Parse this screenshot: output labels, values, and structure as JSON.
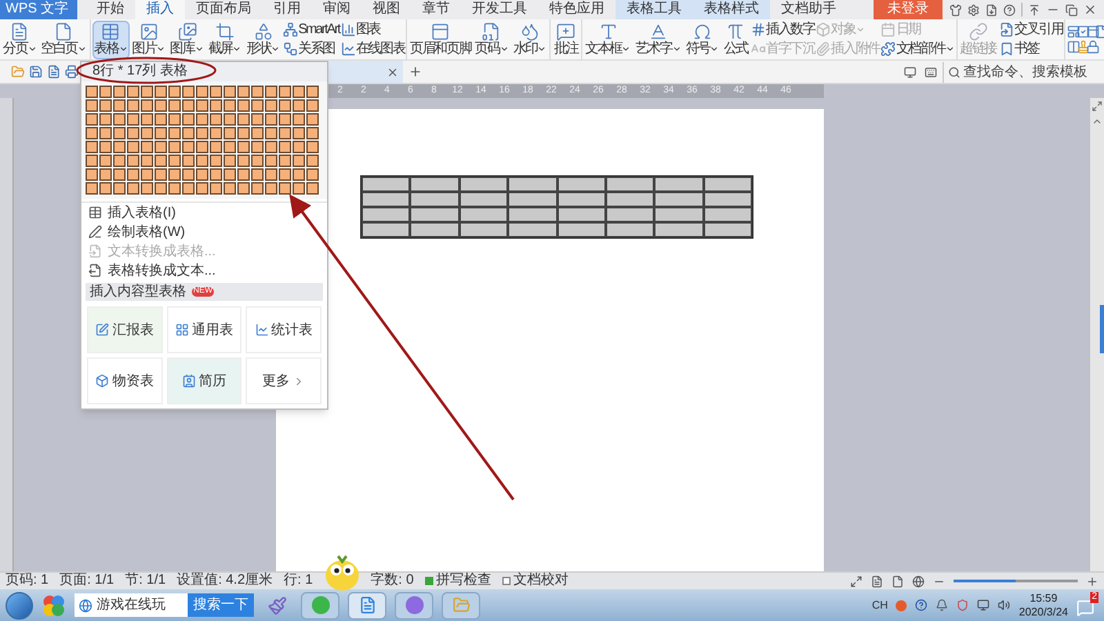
{
  "app_button": {
    "label": "WPS 文字"
  },
  "menu_tabs": [
    {
      "label": "开始",
      "selected": false,
      "kind": "plain"
    },
    {
      "label": "插入",
      "selected": true,
      "kind": "plain"
    },
    {
      "label": "页面布局",
      "selected": false,
      "kind": "plain"
    },
    {
      "label": "引用",
      "selected": false,
      "kind": "plain"
    },
    {
      "label": "审阅",
      "selected": false,
      "kind": "plain"
    },
    {
      "label": "视图",
      "selected": false,
      "kind": "plain"
    },
    {
      "label": "章节",
      "selected": false,
      "kind": "plain"
    },
    {
      "label": "开发工具",
      "selected": false,
      "kind": "plain"
    },
    {
      "label": "特色应用",
      "selected": false,
      "kind": "plain"
    },
    {
      "label": "表格工具",
      "selected": false,
      "kind": "context"
    },
    {
      "label": "表格样式",
      "selected": false,
      "kind": "context"
    },
    {
      "label": "文档助手",
      "selected": false,
      "kind": "plain"
    }
  ],
  "login_button": {
    "label": "未登录"
  },
  "ribbon": {
    "groups": [
      {
        "items": [
          {
            "kind": "large",
            "label": "分页",
            "dropdown": true,
            "pressed": false
          },
          {
            "kind": "large",
            "label": "空白页",
            "dropdown": true,
            "pressed": false
          }
        ]
      },
      {
        "items": [
          {
            "kind": "large",
            "label": "表格",
            "dropdown": true,
            "pressed": true
          },
          {
            "kind": "large",
            "label": "图片",
            "dropdown": true,
            "pressed": false
          },
          {
            "kind": "large",
            "label": "图库",
            "dropdown": true,
            "pressed": false
          },
          {
            "kind": "large",
            "label": "截屏",
            "dropdown": true,
            "pressed": false
          },
          {
            "kind": "large",
            "label": "形状",
            "dropdown": true,
            "pressed": false
          },
          {
            "kind": "stack",
            "entries": [
              {
                "label": "SmartArt",
                "dropdown": false,
                "disabled": false
              },
              {
                "label": "关系图",
                "dropdown": false,
                "disabled": false
              }
            ]
          },
          {
            "kind": "stack",
            "entries": [
              {
                "label": "图表",
                "dropdown": false,
                "disabled": false
              },
              {
                "label": "在线图表",
                "dropdown": false,
                "disabled": false
              }
            ]
          }
        ]
      },
      {
        "items": [
          {
            "kind": "large",
            "label": "页眉和页脚",
            "dropdown": false,
            "pressed": false
          },
          {
            "kind": "large",
            "label": "页码",
            "dropdown": true,
            "pressed": false
          },
          {
            "kind": "large",
            "label": "水印",
            "dropdown": true,
            "pressed": false
          }
        ]
      },
      {
        "items": [
          {
            "kind": "large",
            "label": "批注",
            "dropdown": false,
            "pressed": false
          }
        ]
      },
      {
        "items": [
          {
            "kind": "large",
            "label": "文本框",
            "dropdown": true,
            "pressed": false
          },
          {
            "kind": "large",
            "label": "艺术字",
            "dropdown": true,
            "pressed": false
          },
          {
            "kind": "large",
            "label": "符号",
            "dropdown": true,
            "pressed": false
          },
          {
            "kind": "large",
            "label": "公式",
            "dropdown": false,
            "pressed": false
          },
          {
            "kind": "stack",
            "entries": [
              {
                "label": "插入数字",
                "dropdown": false,
                "disabled": false
              },
              {
                "label": "首字下沉",
                "dropdown": false,
                "disabled": true
              }
            ]
          },
          {
            "kind": "stack",
            "entries": [
              {
                "label": "对象",
                "dropdown": true,
                "disabled": true
              },
              {
                "label": "插入附件",
                "dropdown": false,
                "disabled": true
              }
            ]
          },
          {
            "kind": "stack",
            "entries": [
              {
                "label": "日期",
                "dropdown": false,
                "disabled": true
              },
              {
                "label": "文档部件",
                "dropdown": true,
                "disabled": false
              }
            ]
          }
        ]
      },
      {
        "items": [
          {
            "kind": "large",
            "label": "超链接",
            "dropdown": false,
            "pressed": false,
            "disabled": true
          },
          {
            "kind": "stack",
            "entries": [
              {
                "label": "交叉引用",
                "dropdown": false,
                "disabled": false
              },
              {
                "label": "书签",
                "dropdown": false,
                "disabled": false
              }
            ]
          }
        ]
      }
    ]
  },
  "search": {
    "placeholder": "查找命令、搜索模板"
  },
  "ruler": {
    "numbers": [
      "2",
      "2",
      "4",
      "6",
      "8",
      "12",
      "14",
      "16",
      "18",
      "22",
      "24",
      "26",
      "28",
      "32",
      "34",
      "36",
      "38",
      "42",
      "44",
      "46"
    ]
  },
  "table_menu": {
    "header": "8行 * 17列 表格",
    "grid": [
      {
        "cells": [
          {
            "selected": true
          },
          {
            "selected": true
          },
          {
            "selected": true
          },
          {
            "selected": true
          },
          {
            "selected": true
          },
          {
            "selected": true
          },
          {
            "selected": true
          },
          {
            "selected": true
          },
          {
            "selected": true
          },
          {
            "selected": true
          },
          {
            "selected": true
          },
          {
            "selected": true
          },
          {
            "selected": true
          },
          {
            "selected": true
          },
          {
            "selected": true
          },
          {
            "selected": true
          },
          {
            "selected": true
          }
        ]
      },
      {
        "cells": [
          {
            "selected": true
          },
          {
            "selected": true
          },
          {
            "selected": true
          },
          {
            "selected": true
          },
          {
            "selected": true
          },
          {
            "selected": true
          },
          {
            "selected": true
          },
          {
            "selected": true
          },
          {
            "selected": true
          },
          {
            "selected": true
          },
          {
            "selected": true
          },
          {
            "selected": true
          },
          {
            "selected": true
          },
          {
            "selected": true
          },
          {
            "selected": true
          },
          {
            "selected": true
          },
          {
            "selected": true
          }
        ]
      },
      {
        "cells": [
          {
            "selected": true
          },
          {
            "selected": true
          },
          {
            "selected": true
          },
          {
            "selected": true
          },
          {
            "selected": true
          },
          {
            "selected": true
          },
          {
            "selected": true
          },
          {
            "selected": true
          },
          {
            "selected": true
          },
          {
            "selected": true
          },
          {
            "selected": true
          },
          {
            "selected": true
          },
          {
            "selected": true
          },
          {
            "selected": true
          },
          {
            "selected": true
          },
          {
            "selected": true
          },
          {
            "selected": true
          }
        ]
      },
      {
        "cells": [
          {
            "selected": true
          },
          {
            "selected": true
          },
          {
            "selected": true
          },
          {
            "selected": true
          },
          {
            "selected": true
          },
          {
            "selected": true
          },
          {
            "selected": true
          },
          {
            "selected": true
          },
          {
            "selected": true
          },
          {
            "selected": true
          },
          {
            "selected": true
          },
          {
            "selected": true
          },
          {
            "selected": true
          },
          {
            "selected": true
          },
          {
            "selected": true
          },
          {
            "selected": true
          },
          {
            "selected": true
          }
        ]
      },
      {
        "cells": [
          {
            "selected": true
          },
          {
            "selected": true
          },
          {
            "selected": true
          },
          {
            "selected": true
          },
          {
            "selected": true
          },
          {
            "selected": true
          },
          {
            "selected": true
          },
          {
            "selected": true
          },
          {
            "selected": true
          },
          {
            "selected": true
          },
          {
            "selected": true
          },
          {
            "selected": true
          },
          {
            "selected": true
          },
          {
            "selected": true
          },
          {
            "selected": true
          },
          {
            "selected": true
          },
          {
            "selected": true
          }
        ]
      },
      {
        "cells": [
          {
            "selected": true
          },
          {
            "selected": true
          },
          {
            "selected": true
          },
          {
            "selected": true
          },
          {
            "selected": true
          },
          {
            "selected": true
          },
          {
            "selected": true
          },
          {
            "selected": true
          },
          {
            "selected": true
          },
          {
            "selected": true
          },
          {
            "selected": true
          },
          {
            "selected": true
          },
          {
            "selected": true
          },
          {
            "selected": true
          },
          {
            "selected": true
          },
          {
            "selected": true
          },
          {
            "selected": true
          }
        ]
      },
      {
        "cells": [
          {
            "selected": true
          },
          {
            "selected": true
          },
          {
            "selected": true
          },
          {
            "selected": true
          },
          {
            "selected": true
          },
          {
            "selected": true
          },
          {
            "selected": true
          },
          {
            "selected": true
          },
          {
            "selected": true
          },
          {
            "selected": true
          },
          {
            "selected": true
          },
          {
            "selected": true
          },
          {
            "selected": true
          },
          {
            "selected": true
          },
          {
            "selected": true
          },
          {
            "selected": true
          },
          {
            "selected": true
          }
        ]
      },
      {
        "cells": [
          {
            "selected": true
          },
          {
            "selected": true
          },
          {
            "selected": true
          },
          {
            "selected": true
          },
          {
            "selected": true
          },
          {
            "selected": true
          },
          {
            "selected": true
          },
          {
            "selected": true
          },
          {
            "selected": true
          },
          {
            "selected": true
          },
          {
            "selected": true
          },
          {
            "selected": true
          },
          {
            "selected": true
          },
          {
            "selected": true
          },
          {
            "selected": true
          },
          {
            "selected": true
          },
          {
            "selected": true
          }
        ]
      }
    ],
    "items": [
      {
        "label": "插入表格(I)",
        "disabled": false
      },
      {
        "label": "绘制表格(W)",
        "disabled": false
      },
      {
        "label": "文本转换成表格...",
        "disabled": true
      },
      {
        "label": "表格转换成文本...",
        "disabled": false
      }
    ],
    "section": {
      "label": "插入内容型表格",
      "badge": "NEW"
    },
    "cards": [
      {
        "label": "汇报表"
      },
      {
        "label": "通用表"
      },
      {
        "label": "统计表"
      },
      {
        "label": "物资表"
      },
      {
        "label": "简历"
      },
      {
        "label": "更多"
      }
    ]
  },
  "status_bar": {
    "items": [
      "页码: 1",
      "页面: 1/1",
      "节: 1/1",
      "设置值: 4.2厘米",
      "行: 1",
      "字数: 0"
    ],
    "checks": [
      {
        "label": "拼写检查",
        "on": true
      },
      {
        "label": "文档校对",
        "on": false
      }
    ],
    "zoom": {
      "level": 0.5
    }
  },
  "taskbar": {
    "search": {
      "value": "游戏在线玩"
    },
    "search_button": "搜索一下",
    "tray": {
      "language": "CH",
      "time": "15:59",
      "date": "2020/3/24",
      "badge": "2"
    }
  }
}
